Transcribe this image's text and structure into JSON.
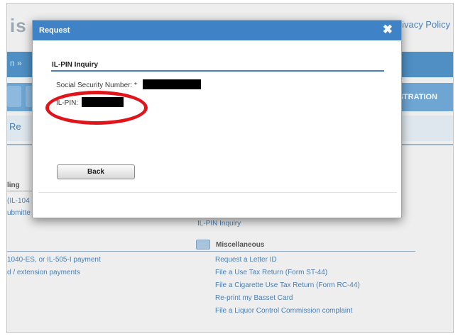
{
  "background": {
    "logo_fragment": "is",
    "privacy_link": "rivacy Policy",
    "breadcrumb_fragment": "n »",
    "nav_right_label": "STRATION",
    "band_fragment": "Re",
    "left_section_heading": "ling",
    "left_items": [
      "(IL-104",
      "ubmitte"
    ],
    "left_links": [
      "1040-ES, or IL-505-I payment",
      "d / extension payments"
    ],
    "right_partial_link": "IL-PIN Inquiry",
    "misc_heading": "Miscellaneous",
    "misc_links": [
      "Request a Letter ID",
      "File a Use Tax Return (Form ST-44)",
      "File a Cigarette Use Tax Return (Form RC-44)",
      "Re-print my Basset Card",
      "File a Liquor Control Commission complaint"
    ]
  },
  "dialog": {
    "title": "Request",
    "close_glyph": "✖",
    "heading": "IL-PIN Inquiry",
    "ssn_label": "Social Security Number: *",
    "pin_label": "IL-PIN:",
    "back_label": "Back"
  },
  "colors": {
    "titlebar": "#3f83c6",
    "highlight_circle": "#e0151c",
    "link": "#4a7fb3"
  }
}
